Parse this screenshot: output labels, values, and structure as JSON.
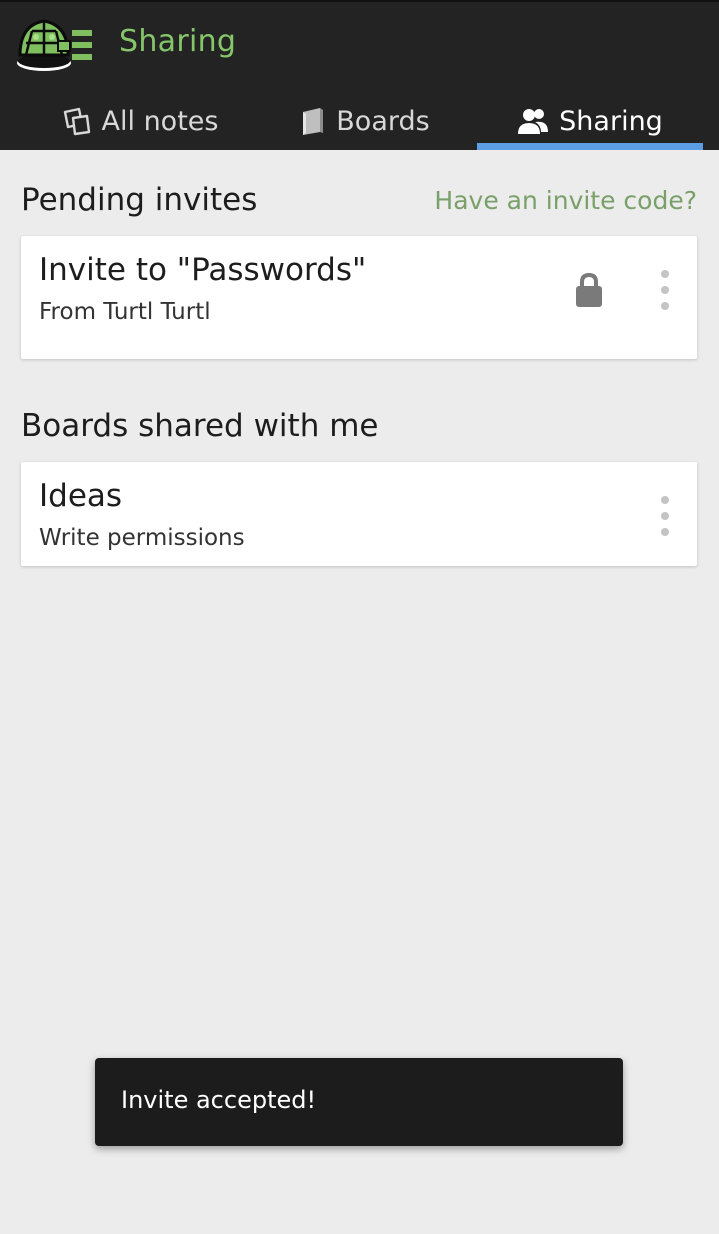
{
  "header": {
    "app_title": "Sharing",
    "logo_icon": "turtle-logo-icon"
  },
  "tabs": [
    {
      "label": "All notes",
      "icon": "notes-icon",
      "active": false
    },
    {
      "label": "Boards",
      "icon": "board-icon",
      "active": false
    },
    {
      "label": "Sharing",
      "icon": "people-icon",
      "active": true
    }
  ],
  "pending": {
    "title": "Pending invites",
    "invite_code_link": "Have an invite code?",
    "items": [
      {
        "title": "Invite to \"Passwords\"",
        "subtitle": "From Turtl Turtl",
        "icon": "lock-icon"
      }
    ]
  },
  "shared": {
    "title": "Boards shared with me",
    "items": [
      {
        "title": "Ideas",
        "subtitle": "Write permissions"
      }
    ]
  },
  "snackbar": {
    "message": "Invite accepted!"
  },
  "colors": {
    "topbar": "#232323",
    "accent_green": "#86c66a",
    "tab_indicator": "#5b9ee6",
    "link_green": "#7aa06a",
    "background": "#ececec"
  }
}
